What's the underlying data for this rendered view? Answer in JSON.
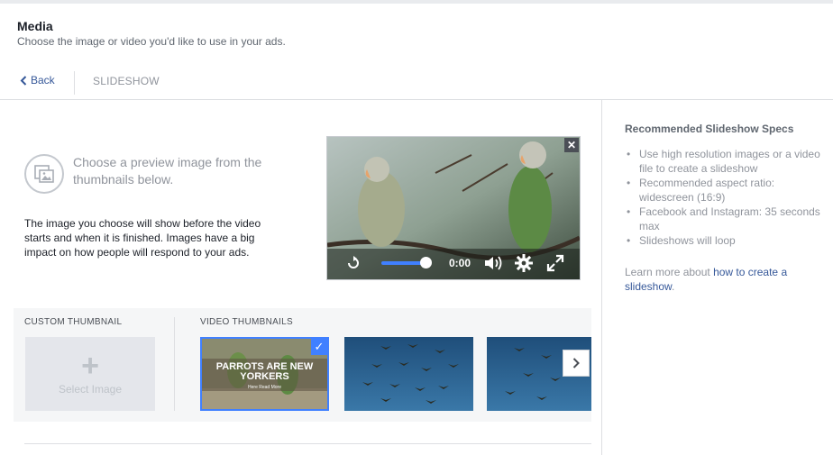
{
  "header": {
    "title": "Media",
    "subtitle": "Choose the image or video you'd like to use in your ads.",
    "back_label": "Back",
    "tab_label": "SLIDESHOW"
  },
  "preview": {
    "instruction": "Choose a preview image from the thumbnails below.",
    "description": "The image you choose will show before the video starts and when it is finished. Images have a big impact on how people will respond to your ads."
  },
  "video_player": {
    "time": "0:00",
    "close_label": "✕"
  },
  "thumbnails": {
    "custom_label": "CUSTOM THUMBNAIL",
    "select_image_label": "Select Image",
    "video_label": "VIDEO THUMBNAILS",
    "first_thumb_text": "PARROTS ARE NEW YORKERS",
    "first_thumb_small": "Here Read More"
  },
  "specs": {
    "title": "Recommended Slideshow Specs",
    "items": [
      "Use high resolution images or a video file to create a slideshow",
      "Recommended aspect ratio: widescreen (16:9)",
      "Facebook and Instagram: 35 seconds max",
      "Slideshows will loop"
    ],
    "learn_prefix": "Learn more about ",
    "learn_link": "how to create a slideshow",
    "learn_suffix": "."
  },
  "colors": {
    "accent": "#4080ff",
    "link": "#365899"
  }
}
